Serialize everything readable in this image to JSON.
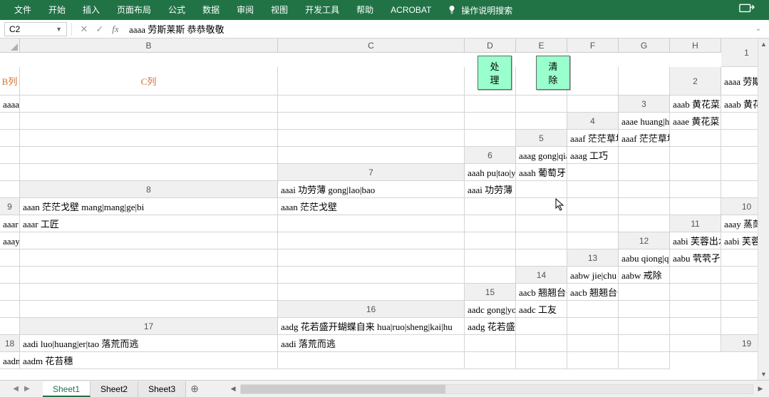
{
  "ribbon": {
    "tabs": [
      "文件",
      "开始",
      "插入",
      "页面布局",
      "公式",
      "数据",
      "审阅",
      "视图",
      "开发工具",
      "帮助",
      "ACROBAT"
    ],
    "search_label": "操作说明搜索"
  },
  "formula_bar": {
    "name_box": "C2",
    "formula": "aaaa 劳斯莱斯 恭恭敬敬"
  },
  "columns": [
    "B",
    "C",
    "D",
    "E",
    "F",
    "G",
    "H"
  ],
  "header_row": {
    "b": "B列",
    "c": "C列"
  },
  "buttons": {
    "process": "处理",
    "clear": "清除"
  },
  "rows": [
    {
      "n": 2,
      "b": "aaaa 劳斯莱斯 lao|si|lai|si 恭恭敬敬",
      "c": "aaaa 劳斯莱斯 恭恭敬敬"
    },
    {
      "n": 3,
      "b": "aaab 黄花菜凉了 黄花菜都凉了 huang|hua|cai",
      "c": "aaab 黄花菜凉了 黄花菜都凉了"
    },
    {
      "n": 4,
      "b": "aaae huang|hua|cai 黄花菜",
      "c": "aaae 黄花菜"
    },
    {
      "n": 5,
      "b": "aaaf 茫茫草地 mang|mang|cao|di",
      "c": "aaaf 茫茫草地"
    },
    {
      "n": 6,
      "b": "aaag gong|qiao 工巧",
      "c": "aaag 工巧"
    },
    {
      "n": 7,
      "b": "aaah pu|tao|ya 葡萄牙",
      "c": "aaah 葡萄牙"
    },
    {
      "n": 8,
      "b": "aaai 功劳薄 gong|lao|bao",
      "c": "aaai 功劳薄"
    },
    {
      "n": 9,
      "b": "aaan 茫茫戈壁 mang|mang|ge|bi",
      "c": "aaan 茫茫戈壁"
    },
    {
      "n": 10,
      "b": "aaar gong|jiang 工匠",
      "c": "aaar 工匠"
    },
    {
      "n": 11,
      "b": "aaay 蒸茼蒿 zheng|tong|hao 劳苦功高",
      "c": "aaay 蒸茼蒿 劳苦功高"
    },
    {
      "n": 12,
      "b": "aabi 芙蓉出水 fu|rong|chu|shui",
      "c": "aabi 芙蓉出水"
    },
    {
      "n": 13,
      "b": "aabu qiong|qiong|jie|li 茕茕孑立",
      "c": "aabu 茕茕孑立"
    },
    {
      "n": 14,
      "b": "aabw jie|chu 戒除",
      "c": "aabw 戒除"
    },
    {
      "n": 15,
      "b": "aacb 翘翘台子 qiao|qiao|tai|zi",
      "c": "aacb 翘翘台子"
    },
    {
      "n": 16,
      "b": "aadc gong|you 工友",
      "c": "aadc 工友"
    },
    {
      "n": 17,
      "b": "aadg 花若盛开蝴蝶自来 hua|ruo|sheng|kai|hu",
      "c": "aadg 花若盛开蝴蝶自来"
    },
    {
      "n": 18,
      "b": "aadi luo|huang|er|tao 落荒而逃",
      "c": "aadi 落荒而逃"
    },
    {
      "n": 19,
      "b": "aadm hua|tai|sui 花苔穗",
      "c": "aadm 花苔穗"
    }
  ],
  "sheets": [
    "Sheet1",
    "Sheet2",
    "Sheet3"
  ],
  "active_sheet": 0
}
